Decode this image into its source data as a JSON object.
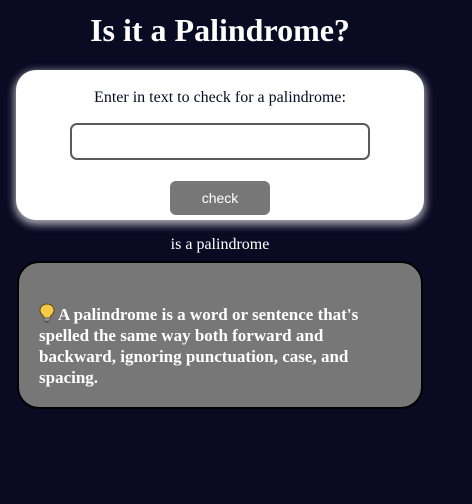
{
  "page": {
    "title": "Is it a Palindrome?"
  },
  "form": {
    "label": "Enter in text to check for a palindrome:",
    "input_value": "",
    "input_placeholder": "",
    "check_label": "check"
  },
  "result": {
    "text": "is a palindrome"
  },
  "info": {
    "icon": "lightbulb-icon",
    "text": "A palindrome is a word or sentence that's spelled the same way both forward and backward, ignoring punctuation, case, and spacing."
  },
  "colors": {
    "background": "#0a0a23",
    "card": "#ffffff",
    "button": "#777777",
    "info_box": "#777777",
    "text": "#ffffff"
  }
}
